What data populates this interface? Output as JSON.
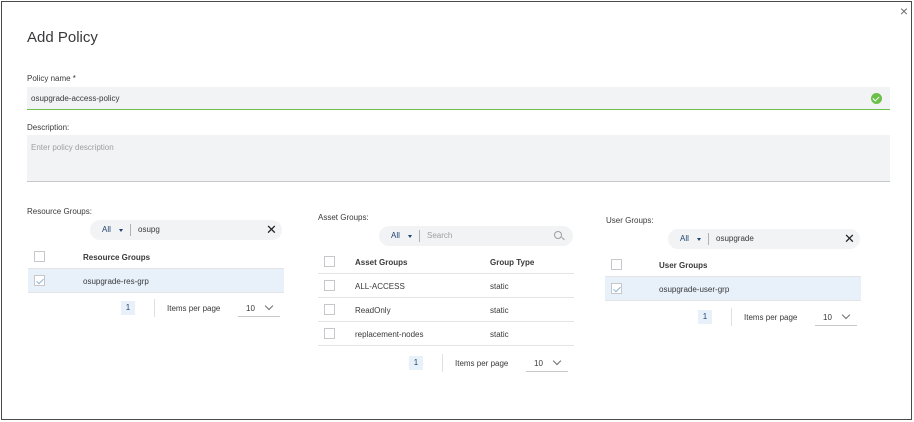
{
  "dialog": {
    "title": "Add Policy",
    "close_label": "×"
  },
  "policy_name": {
    "label": "Policy name *",
    "value": "osupgrade-access-policy",
    "valid": true
  },
  "description": {
    "label": "Description:",
    "placeholder": "Enter policy description"
  },
  "resource_groups": {
    "label": "Resource Groups:",
    "filter_scope": "All",
    "search_value": "osupg",
    "columns": [
      "Resource Groups"
    ],
    "rows": [
      {
        "name": "osupgrade-res-grp",
        "checked": true
      }
    ],
    "page": "1",
    "items_per_page_label": "Items per page",
    "items_per_page": "10"
  },
  "asset_groups": {
    "label": "Asset Groups:",
    "filter_scope": "All",
    "search_placeholder": "Search",
    "columns": [
      "Asset Groups",
      "Group Type"
    ],
    "rows": [
      {
        "name": "ALL-ACCESS",
        "type": "static",
        "checked": false
      },
      {
        "name": "ReadOnly",
        "type": "static",
        "checked": false
      },
      {
        "name": "replacement-nodes",
        "type": "static",
        "checked": false
      }
    ],
    "page": "1",
    "items_per_page_label": "Items per page",
    "items_per_page": "10"
  },
  "user_groups": {
    "label": "User Groups:",
    "filter_scope": "All",
    "search_value": "osupgrade",
    "columns": [
      "User Groups"
    ],
    "rows": [
      {
        "name": "osupgrade-user-grp",
        "checked": true
      }
    ],
    "page": "1",
    "items_per_page_label": "Items per page",
    "items_per_page": "10"
  },
  "icons": {
    "close": "close-icon",
    "valid": "check-circle-icon",
    "clear": "clear-x-icon",
    "search": "search-icon",
    "dropdown": "caret-down-icon",
    "chevron": "chevron-down-icon"
  },
  "colors": {
    "accent": "#1e4471",
    "valid": "#6cc04a",
    "selected_row": "#e8f1fa",
    "input_bg": "#f2f3f5"
  }
}
